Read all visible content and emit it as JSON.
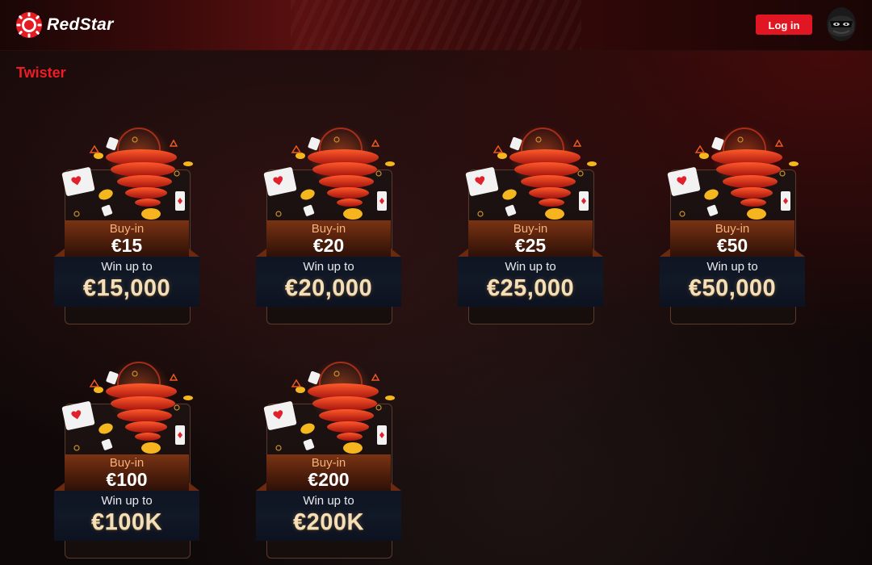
{
  "header": {
    "brand": "RedStar",
    "login_label": "Log in"
  },
  "page": {
    "title": "Twister"
  },
  "colors": {
    "accent": "#e01722",
    "title": "#ee1c25",
    "buyin_label": "#f6b07a",
    "win_value": "#f5dfb8"
  },
  "cards": [
    {
      "buyin_label": "Buy-in",
      "buyin": "€15",
      "win_label": "Win up to",
      "win": "€15,000"
    },
    {
      "buyin_label": "Buy-in",
      "buyin": "€20",
      "win_label": "Win up to",
      "win": "€20,000"
    },
    {
      "buyin_label": "Buy-in",
      "buyin": "€25",
      "win_label": "Win up to",
      "win": "€25,000"
    },
    {
      "buyin_label": "Buy-in",
      "buyin": "€50",
      "win_label": "Win up to",
      "win": "€50,000"
    },
    {
      "buyin_label": "Buy-in",
      "buyin": "€100",
      "win_label": "Win up to",
      "win": "€100K"
    },
    {
      "buyin_label": "Buy-in",
      "buyin": "€200",
      "win_label": "Win up to",
      "win": "€200K"
    }
  ],
  "icons": {
    "logo": "poker-chip-icon",
    "avatar": "masked-user-icon",
    "card_art": "tornado-cards-coins-icon"
  }
}
